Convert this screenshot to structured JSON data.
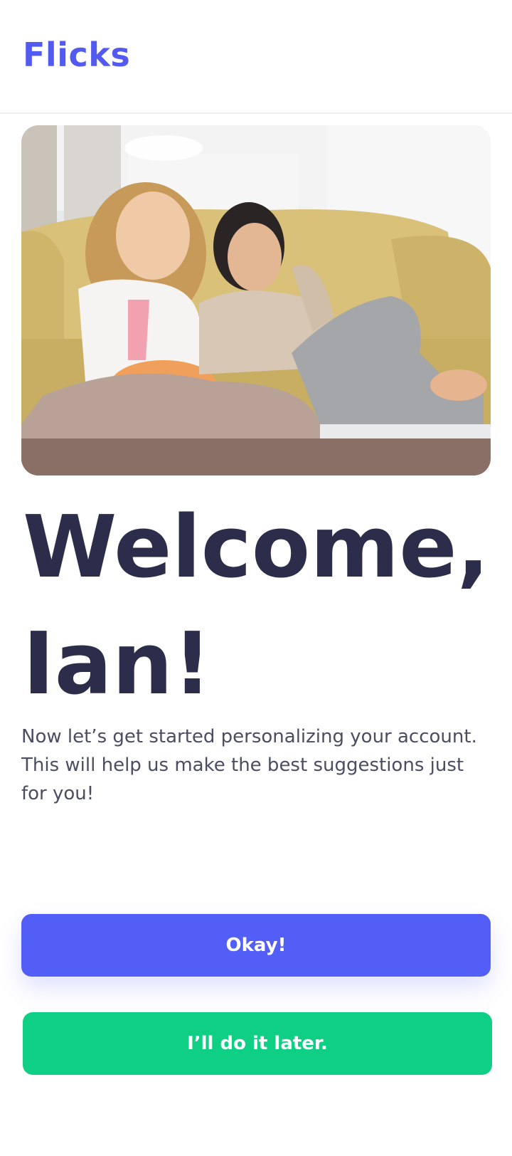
{
  "app": {
    "brand": "Flicks"
  },
  "hero": {
    "image_description": "two-women-on-sofa-watching-tv-with-popcorn"
  },
  "welcome": {
    "title": "Welcome, Ian!",
    "subtitle": "Now let’s get started personalizing your account. This will help us make the best suggestions just for you!"
  },
  "actions": {
    "primary_label": "Okay!",
    "secondary_label": "I’ll do it later."
  },
  "colors": {
    "brand": "#525af0",
    "primary_button": "#525ef6",
    "secondary_button": "#0ecf84",
    "heading": "#2b2d4a"
  }
}
